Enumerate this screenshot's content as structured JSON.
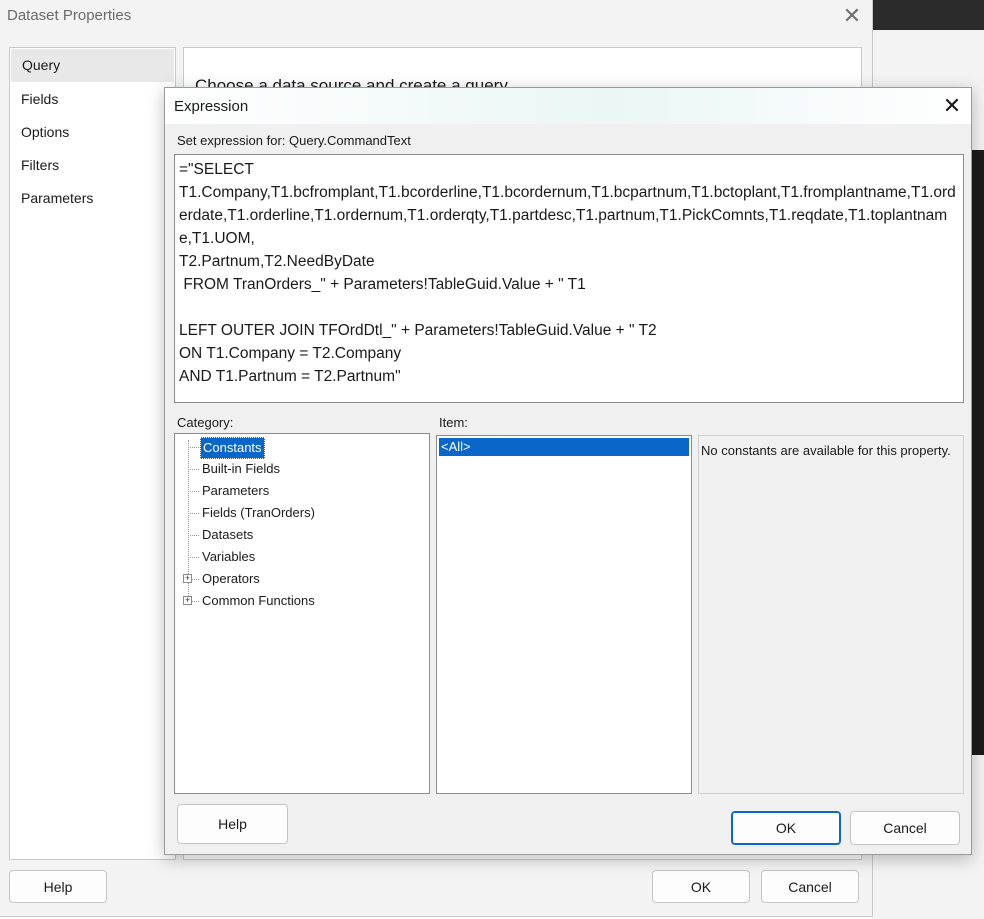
{
  "outer_dialog": {
    "title": "Dataset Properties",
    "close_glyph": "✕",
    "nav_items": [
      {
        "label": "Query",
        "selected": true
      },
      {
        "label": "Fields",
        "selected": false
      },
      {
        "label": "Options",
        "selected": false
      },
      {
        "label": "Filters",
        "selected": false
      },
      {
        "label": "Parameters",
        "selected": false
      }
    ],
    "content_heading": "Choose a data source and create a query.",
    "help_label": "Help",
    "ok_label": "OK",
    "cancel_label": "Cancel"
  },
  "expression_dialog": {
    "title": "Expression",
    "close_glyph": "✕",
    "set_label": "Set expression for: Query.CommandText",
    "expression_text": "=\"SELECT\nT1.Company,T1.bcfromplant,T1.bcorderline,T1.bcordernum,T1.bcpartnum,T1.bctoplant,T1.fromplantname,T1.orderdate,T1.orderline,T1.ordernum,T1.orderqty,T1.partdesc,T1.partnum,T1.PickComnts,T1.reqdate,T1.toplantname,T1.UOM,\nT2.Partnum,T2.NeedByDate\n FROM TranOrders_\" + Parameters!TableGuid.Value + \" T1\n\nLEFT OUTER JOIN TFOrdDtl_\" + Parameters!TableGuid.Value + \" T2\nON T1.Company = T2.Company\nAND T1.Partnum = T2.Partnum\"",
    "category_label": "Category:",
    "item_label": "Item:",
    "categories": [
      {
        "label": "Constants",
        "selected": true,
        "expandable": false
      },
      {
        "label": "Built-in Fields",
        "selected": false,
        "expandable": false
      },
      {
        "label": "Parameters",
        "selected": false,
        "expandable": false
      },
      {
        "label": "Fields (TranOrders)",
        "selected": false,
        "expandable": false
      },
      {
        "label": "Datasets",
        "selected": false,
        "expandable": false
      },
      {
        "label": "Variables",
        "selected": false,
        "expandable": false
      },
      {
        "label": "Operators",
        "selected": false,
        "expandable": true
      },
      {
        "label": "Common Functions",
        "selected": false,
        "expandable": true
      }
    ],
    "items": [
      {
        "label": "<All>",
        "selected": true
      }
    ],
    "description": "No constants are available for this property.",
    "help_label": "Help",
    "ok_label": "OK",
    "cancel_label": "Cancel"
  },
  "colors": {
    "selection": "#0a66c8",
    "dialog_bg": "#f0f0f0"
  }
}
